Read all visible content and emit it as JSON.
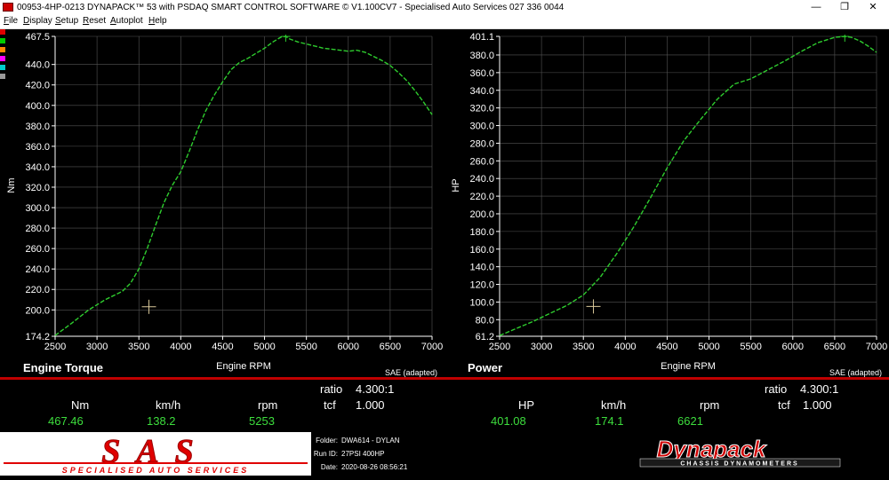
{
  "window": {
    "title": "00953-4HP-0213 DYNAPACK™ 53 with PSDAQ SMART CONTROL SOFTWARE © V1.100CV7 - Specialised Auto Services 027 336 0044",
    "minimize": "—",
    "maximize": "❐",
    "close": "✕"
  },
  "menu": [
    "File",
    "Display",
    "Setup",
    "Reset",
    "Autoplot",
    "Help"
  ],
  "colors": {
    "trace": "#2ecc2e",
    "readout_value": "#3dde3d",
    "red_bar": "#c00000",
    "strip": [
      "#e00000",
      "#00cc00",
      "#ff8800",
      "#ff00ff",
      "#00cccc",
      "#999999"
    ]
  },
  "chart_data": [
    {
      "type": "line",
      "title": "Engine Torque",
      "xlabel": "Engine RPM",
      "ylabel": "Nm",
      "note": "SAE (adapted)",
      "xlim": [
        2500,
        7000
      ],
      "ylim": [
        174.2,
        467.5
      ],
      "xticks": [
        "2500",
        "3000",
        "3500",
        "4000",
        "4500",
        "5000",
        "5500",
        "6000",
        "6500",
        "7000"
      ],
      "yticks": [
        "174.2",
        "200.0",
        "220.0",
        "240.0",
        "260.0",
        "280.0",
        "300.0",
        "320.0",
        "340.0",
        "360.0",
        "380.0",
        "400.0",
        "420.0",
        "440.0",
        "467.5"
      ],
      "cursor": {
        "x": 3620,
        "y": 203
      },
      "peak": {
        "x": 5253,
        "y": 467.46
      },
      "series": [
        {
          "x": [
            2500,
            2700,
            2900,
            3100,
            3300,
            3400,
            3500,
            3600,
            3700,
            3800,
            3900,
            4000,
            4100,
            4200,
            4300,
            4400,
            4500,
            4600,
            4700,
            4800,
            4900,
            5000,
            5100,
            5200,
            5253,
            5300,
            5400,
            5500,
            5600,
            5700,
            5800,
            5900,
            6000,
            6100,
            6200,
            6300,
            6400,
            6500,
            6600,
            6700,
            6800,
            6900,
            7000
          ],
          "y": [
            175,
            187,
            200,
            210,
            218,
            226,
            240,
            260,
            283,
            305,
            322,
            335,
            355,
            376,
            395,
            410,
            423,
            435,
            442,
            446,
            451,
            456,
            462,
            467,
            467.46,
            465,
            462,
            460,
            458,
            456,
            455,
            454,
            453,
            454,
            452,
            448,
            444,
            439,
            432,
            424,
            414,
            403,
            391
          ]
        }
      ]
    },
    {
      "type": "line",
      "title": "Power",
      "xlabel": "Engine RPM",
      "ylabel": "HP",
      "note": "SAE (adapted)",
      "xlim": [
        2500,
        7000
      ],
      "ylim": [
        61.2,
        401.1
      ],
      "xticks": [
        "2500",
        "3000",
        "3500",
        "4000",
        "4500",
        "5000",
        "5500",
        "6000",
        "6500",
        "7000"
      ],
      "yticks": [
        "61.2",
        "80.0",
        "100.0",
        "120.0",
        "140.0",
        "160.0",
        "180.0",
        "200.0",
        "220.0",
        "240.0",
        "260.0",
        "280.0",
        "300.0",
        "320.0",
        "340.0",
        "360.0",
        "380.0",
        "401.1"
      ],
      "cursor": {
        "x": 3620,
        "y": 95
      },
      "peak": {
        "x": 6621,
        "y": 401.08
      },
      "series": [
        {
          "x": [
            2500,
            2700,
            2900,
            3100,
            3300,
            3500,
            3700,
            3900,
            4100,
            4300,
            4500,
            4700,
            4900,
            5100,
            5300,
            5500,
            5700,
            5900,
            6100,
            6300,
            6500,
            6621,
            6700,
            6800,
            6900,
            7000
          ],
          "y": [
            62,
            70,
            78,
            87,
            96,
            108,
            128,
            155,
            185,
            218,
            252,
            283,
            307,
            330,
            347,
            353,
            363,
            373,
            384,
            394,
            400,
            401.08,
            400,
            396,
            390,
            383
          ]
        }
      ]
    }
  ],
  "readouts": {
    "left": {
      "ratio_label": "ratio",
      "ratio": "4.300:1",
      "tcf_label": "tcf",
      "tcf": "1.000",
      "labels": [
        "Nm",
        "km/h",
        "rpm"
      ],
      "values": [
        "467.46",
        "138.2",
        "5253"
      ]
    },
    "right": {
      "ratio_label": "ratio",
      "ratio": "4.300:1",
      "tcf_label": "tcf",
      "tcf": "1.000",
      "labels": [
        "HP",
        "km/h",
        "rpm"
      ],
      "values": [
        "401.08",
        "174.1",
        "6621"
      ]
    }
  },
  "footer": {
    "logo_text": "SAS",
    "logo_subtitle": "SPECIALISED AUTO SERVICES",
    "folder_label": "Folder:",
    "folder": "DWA614 - DYLAN",
    "run_label": "Run ID:",
    "run": "27PSI 400HP",
    "date_label": "Date:",
    "date": "2020-08-26 08:56:21",
    "dyna_logo": "Dynapack",
    "dyna_sub": "CHASSIS DYNAMOMETERS"
  }
}
